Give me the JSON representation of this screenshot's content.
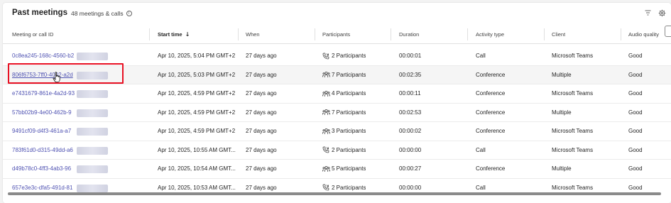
{
  "header": {
    "title": "Past meetings",
    "count_text": "48 meetings & calls",
    "info_symbol": "i"
  },
  "columns": {
    "id": "Meeting or call ID",
    "start_time": "Start time",
    "sort_arrow": "↓",
    "when": "When",
    "participants": "Participants",
    "duration": "Duration",
    "activity_type": "Activity type",
    "client": "Client",
    "audio_quality": "Audio quality"
  },
  "rows": [
    {
      "id": "0c8ea245-168c-4560-b2",
      "start": "Apr 10, 2025, 5:04 PM GMT+2",
      "when": "27 days ago",
      "participants": "2 Participants",
      "picon": "call",
      "duration": "00:00:01",
      "activity": "Call",
      "client": "Microsoft Teams",
      "audio": "Good"
    },
    {
      "id": "806f6753-7ff0-4002-a2d",
      "start": "Apr 10, 2025, 5:03 PM GMT+2",
      "when": "27 days ago",
      "participants": "7 Participants",
      "picon": "group",
      "duration": "00:02:35",
      "activity": "Conference",
      "client": "Multiple",
      "audio": "Good"
    },
    {
      "id": "e7431679-861e-4a2d-93",
      "start": "Apr 10, 2025, 4:59 PM GMT+2",
      "when": "27 days ago",
      "participants": "4 Participants",
      "picon": "group",
      "duration": "00:00:11",
      "activity": "Conference",
      "client": "Microsoft Teams",
      "audio": "Good"
    },
    {
      "id": "57bb02b9-4e00-462b-9",
      "start": "Apr 10, 2025, 4:59 PM GMT+2",
      "when": "27 days ago",
      "participants": "7 Participants",
      "picon": "group",
      "duration": "00:02:53",
      "activity": "Conference",
      "client": "Multiple",
      "audio": "Good"
    },
    {
      "id": "9491cf09-d4f3-461a-a7",
      "start": "Apr 10, 2025, 4:59 PM GMT+2",
      "when": "27 days ago",
      "participants": "3 Participants",
      "picon": "group",
      "duration": "00:00:02",
      "activity": "Conference",
      "client": "Microsoft Teams",
      "audio": "Good"
    },
    {
      "id": "783f61d0-d315-49dd-a6",
      "start": "Apr 10, 2025, 10:55 AM GMT...",
      "when": "27 days ago",
      "participants": "2 Participants",
      "picon": "call",
      "duration": "00:00:00",
      "activity": "Call",
      "client": "Microsoft Teams",
      "audio": "Good"
    },
    {
      "id": "d49b78c0-4ff3-4ab3-96",
      "start": "Apr 10, 2025, 10:54 AM GMT...",
      "when": "27 days ago",
      "participants": "5 Participants",
      "picon": "group",
      "duration": "00:00:27",
      "activity": "Conference",
      "client": "Multiple",
      "audio": "Good"
    },
    {
      "id": "657e3e3c-dfa5-491d-81",
      "start": "Apr 10, 2025, 10:53 AM GMT...",
      "when": "27 days ago",
      "participants": "2 Participants",
      "picon": "call",
      "duration": "00:00:00",
      "activity": "Call",
      "client": "Microsoft Teams",
      "audio": "Good"
    }
  ],
  "icons": {
    "filter": "filter-icon",
    "settings": "settings-icon",
    "call": "phone-icon",
    "group": "people-icon",
    "cursor": "hand-cursor-icon"
  },
  "colors": {
    "link": "#4f52b2",
    "highlight_border": "#e81123"
  }
}
